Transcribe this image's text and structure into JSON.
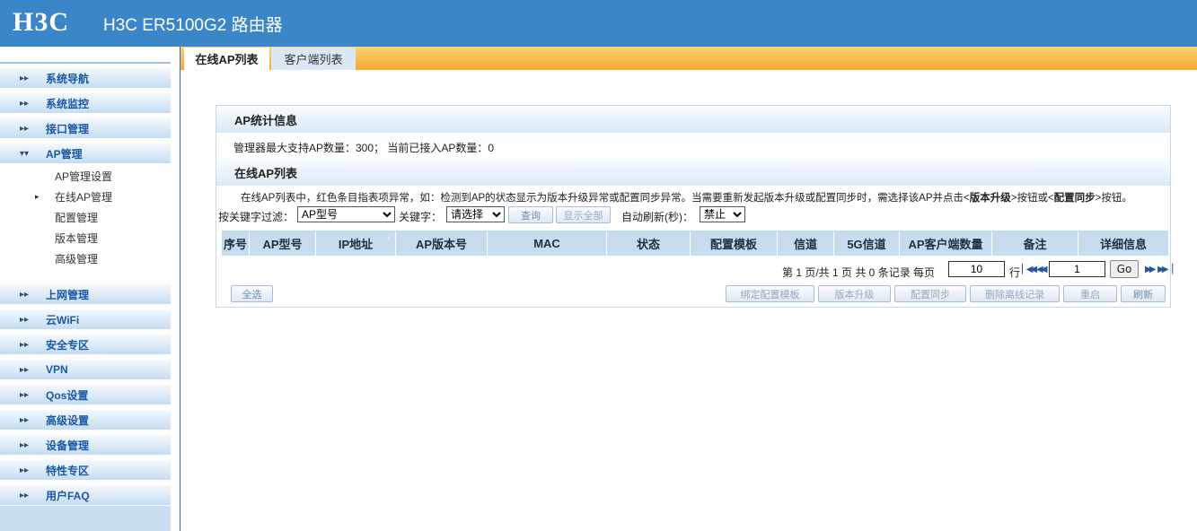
{
  "header": {
    "logo": "H3C",
    "title": "H3C ER5100G2 路由器"
  },
  "sidebar": {
    "items_top": [
      {
        "label": "系统导航"
      },
      {
        "label": "系统监控"
      },
      {
        "label": "接口管理"
      },
      {
        "label": "AP管理"
      }
    ],
    "sub_items": [
      {
        "label": "AP管理设置",
        "active": false
      },
      {
        "label": "在线AP管理",
        "active": true
      },
      {
        "label": "配置管理",
        "active": false
      },
      {
        "label": "版本管理",
        "active": false
      },
      {
        "label": "高级管理",
        "active": false
      }
    ],
    "items_bottom": [
      {
        "label": "上网管理"
      },
      {
        "label": "云WiFi"
      },
      {
        "label": "安全专区"
      },
      {
        "label": "VPN"
      },
      {
        "label": "Qos设置"
      },
      {
        "label": "高级设置"
      },
      {
        "label": "设备管理"
      },
      {
        "label": "特性专区"
      },
      {
        "label": "用户FAQ"
      }
    ]
  },
  "tabs": [
    {
      "label": "在线AP列表",
      "active": true
    },
    {
      "label": "客户端列表",
      "active": false
    }
  ],
  "stats": {
    "title": "AP统计信息",
    "text": "管理器最大支持AP数量：300；  当前已接入AP数量：0"
  },
  "ap_list": {
    "title": "在线AP列表",
    "desc_pre": "在线AP列表中，红色条目指表项异常，如：检测到AP的状态显示为版本升级异常或配置同步异常。当需要重新发起版本升级或配置同步时，需选择该AP并点击<",
    "desc_b1": "版本升级",
    "desc_mid": ">按钮或<",
    "desc_b2": "配置同步",
    "desc_post": ">按钮。",
    "filter_label": "按关键字过滤：",
    "filter_value": "AP型号",
    "keyword_label": "关键字：",
    "keyword_value": "请选择",
    "query_button": "查询",
    "show_all_button": "显示全部",
    "refresh_label": "自动刷新(秒)：",
    "refresh_value": "禁止",
    "columns": [
      "序号",
      "AP型号",
      "IP地址",
      "AP版本号",
      "MAC",
      "状态",
      "配置模板",
      "信道",
      "5G信道",
      "AP客户端数量",
      "备注",
      "详细信息"
    ],
    "sort_indicator": "↓",
    "pagination": {
      "info": "第 1 页/共 1 页 共 0 条记录 每页",
      "per_page": "10",
      "rows_label": "行",
      "page": "1",
      "go": "Go"
    },
    "buttons": {
      "select_all": "全选",
      "bind_template": "绑定配置模板",
      "upgrade": "版本升级",
      "sync": "配置同步",
      "delete_offline": "删除离线记录",
      "restart": "重启",
      "refresh": "刷新"
    }
  }
}
